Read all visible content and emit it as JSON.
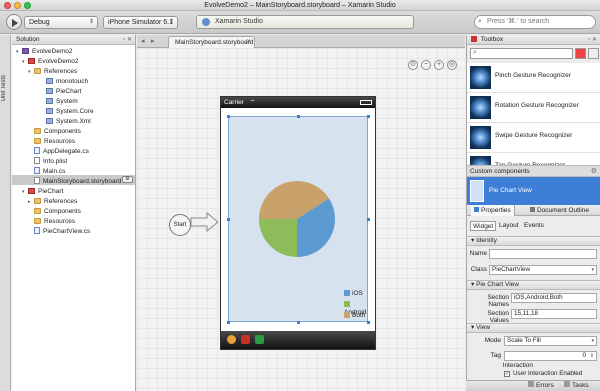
{
  "window": {
    "title": "EvolveDemo2 – MainStoryboard.storyboard – Xamarin Studio"
  },
  "toolbar": {
    "configuration": "Debug",
    "device": "iPhone Simulator 6.1",
    "status": "Xamarin Studio",
    "search_placeholder": "Press '⌘.' to search"
  },
  "left_strip": {
    "label": "Unit Tests"
  },
  "solution": {
    "title": "Solution",
    "items": [
      {
        "label": "EvolveDemo2",
        "kind": "sol"
      },
      {
        "label": "EvolveDemo2",
        "kind": "proj"
      },
      {
        "label": "References",
        "kind": "folder"
      },
      {
        "label": "monotouch",
        "kind": "ref"
      },
      {
        "label": "PieChart",
        "kind": "ref"
      },
      {
        "label": "System",
        "kind": "ref"
      },
      {
        "label": "System.Core",
        "kind": "ref"
      },
      {
        "label": "System.Xml",
        "kind": "ref"
      },
      {
        "label": "Components",
        "kind": "folder"
      },
      {
        "label": "Resources",
        "kind": "folder"
      },
      {
        "label": "AppDelegate.cs",
        "kind": "cs"
      },
      {
        "label": "Info.plist",
        "kind": "file"
      },
      {
        "label": "Main.cs",
        "kind": "cs"
      },
      {
        "label": "MainStoryboard.storyboard",
        "kind": "file"
      },
      {
        "label": "PieChart",
        "kind": "proj"
      },
      {
        "label": "References",
        "kind": "folder"
      },
      {
        "label": "Components",
        "kind": "folder"
      },
      {
        "label": "Resources",
        "kind": "folder"
      },
      {
        "label": "PieChartView.cs",
        "kind": "cs"
      }
    ]
  },
  "document": {
    "tab_label": "MainStoryboard.storyboard",
    "start_label": "Start",
    "carrier": "Carrier",
    "chart": {
      "slices": [
        {
          "name": "iOS",
          "value": 15,
          "color": "#5b9bd1"
        },
        {
          "name": "Android",
          "value": 11,
          "color": "#8dbd5a"
        },
        {
          "name": "Both",
          "value": 18,
          "color": "#c9a26b"
        }
      ]
    }
  },
  "toolbox": {
    "title": "Toolbox",
    "items": [
      {
        "label": "Pinch Gesture Recognizer"
      },
      {
        "label": "Rotation Gesture Recognizer"
      },
      {
        "label": "Swipe Gesture Recognizer"
      },
      {
        "label": "Tap Gesture Recognizer"
      }
    ],
    "custom_header": "Custom components",
    "custom_item": "Pie Chart View"
  },
  "properties": {
    "tab_properties": "Properties",
    "tab_outline": "Document Outline",
    "subtabs": [
      "Widget",
      "Layout",
      "Events"
    ],
    "identity_header": "Identity",
    "name_label": "Name",
    "name_value": "",
    "class_label": "Class",
    "class_value": "PieChartView",
    "piechart_header": "Pie Chart View",
    "section_names_label": "Section Names",
    "section_names_value": "iOS,Android,Both",
    "section_values_label": "Section Values",
    "section_values_value": "15,11,18",
    "view_header": "View",
    "mode_label": "Mode",
    "mode_value": "Scale To Fill",
    "tag_label": "Tag",
    "tag_value": "0",
    "interaction_label": "Interaction",
    "interaction_option": "User Interaction Enabled"
  },
  "bottom": {
    "errors": "Errors",
    "tasks": "Tasks"
  }
}
